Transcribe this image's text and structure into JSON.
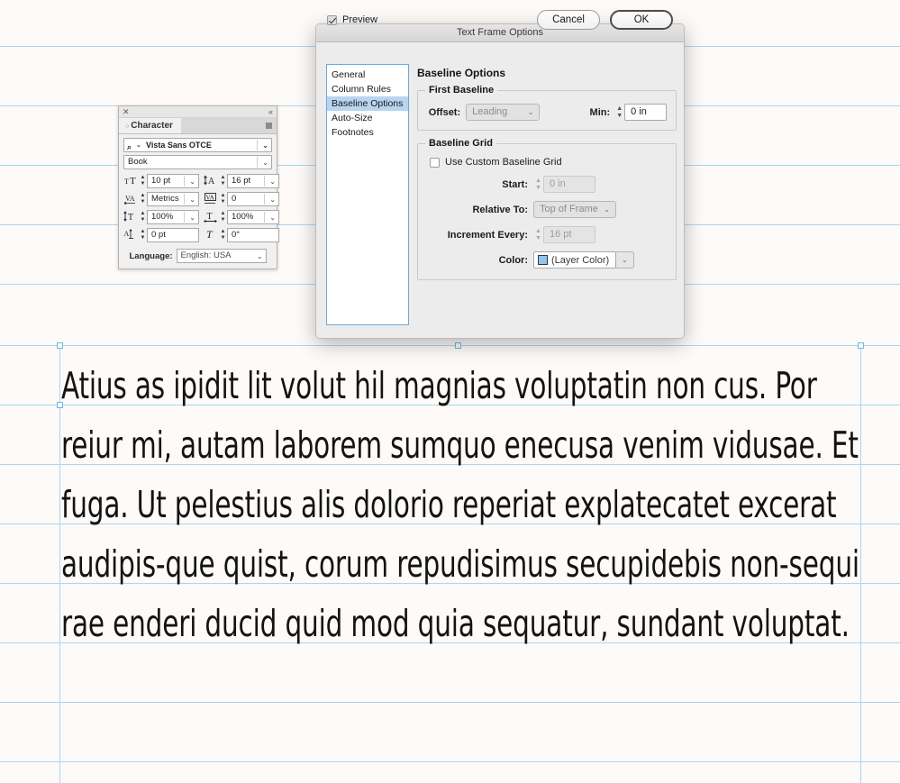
{
  "canvas": {
    "background_color": "#fdfaf7",
    "guide_color": "#a8d6f5",
    "horizontal_guides": [
      51,
      117,
      183,
      249,
      315,
      383,
      449,
      515,
      581,
      647,
      713,
      779,
      845
    ],
    "vertical_guides": [
      66,
      955
    ],
    "body_text": "Atius as ipidit lit volut hil magnias voluptatin non cus. Por reiur mi, autam laborem sumquo enecusa venim vidusae. Et fuga. Ut pelestius alis dolorio reperiat explatecatet excerat audipis-que quist, corum repudisimus secupidebis non-sequi rae enderi ducid quid mod quia sequatur, sundant voluptat.",
    "body_lines": [
      "Atius as ipidit lit volut hil magnias voluptatin",
      "non cus. Por reiur mi, autam laborem sumquo",
      "enecusa venim vidusae. Et fuga. Ut pelestius alis",
      "dolorio reperiat explatecatet excerat audipis-",
      "que quist, corum repudisimus secupidebis non-",
      "sequi rae enderi ducid quid mod quia sequatur,",
      "sundant voluptat."
    ]
  },
  "character_panel": {
    "close_glyph": "✕",
    "collapse_glyph": "«",
    "tab_label": "Character",
    "tab_dot": "○",
    "font_family": {
      "value": "Vista Sans OTCE",
      "search_glyph": "⌕",
      "caret": "⌄"
    },
    "font_style": {
      "value": "Book",
      "caret": "⌄"
    },
    "fields": [
      {
        "icon": "TT",
        "icon_name": "font-size-icon",
        "value": "10 pt",
        "has_dropdown": true
      },
      {
        "icon": "A",
        "icon_name": "leading-icon",
        "value": "16 pt",
        "has_dropdown": true
      },
      {
        "icon": "VA",
        "icon_name": "kerning-icon",
        "value": "Metrics",
        "has_dropdown": true
      },
      {
        "icon": "VA",
        "icon_name": "tracking-icon",
        "value": "0",
        "has_dropdown": true
      },
      {
        "icon": "T",
        "icon_name": "vertical-scale-icon",
        "value": "100%",
        "has_dropdown": true
      },
      {
        "icon": "T",
        "icon_name": "horizontal-scale-icon",
        "value": "100%",
        "has_dropdown": true
      },
      {
        "icon": "A",
        "icon_name": "baseline-shift-icon",
        "value": "0 pt",
        "has_dropdown": false
      },
      {
        "icon": "T",
        "icon_name": "skew-italic-icon",
        "value": "0°",
        "has_dropdown": false
      }
    ],
    "language_label": "Language:",
    "language_value": "English: USA",
    "language_caret": "⌄"
  },
  "dialog": {
    "title": "Text Frame Options",
    "tabs": [
      {
        "label": "General",
        "selected": false
      },
      {
        "label": "Column Rules",
        "selected": false
      },
      {
        "label": "Baseline Options",
        "selected": true
      },
      {
        "label": "Auto-Size",
        "selected": false
      },
      {
        "label": "Footnotes",
        "selected": false
      }
    ],
    "selected_tab_color": "#b9d4f0",
    "panel_heading": "Baseline Options",
    "first_baseline": {
      "group_title": "First Baseline",
      "offset_label": "Offset:",
      "offset_value": "Leading",
      "offset_caret": "⌄",
      "min_label": "Min:",
      "min_value": "0 in"
    },
    "baseline_grid": {
      "group_title": "Baseline Grid",
      "use_custom_label": "Use Custom Baseline Grid",
      "use_custom_checked": false,
      "start_label": "Start:",
      "start_value": "0 in",
      "relative_label": "Relative To:",
      "relative_value": "Top of Frame",
      "relative_caret": "⌄",
      "increment_label": "Increment Every:",
      "increment_value": "16 pt",
      "color_label": "Color:",
      "color_value": "(Layer Color)",
      "color_swatch_hex": "#8ec6f0",
      "color_caret": "⌄"
    },
    "footer": {
      "preview_label": "Preview",
      "preview_checked": true,
      "cancel_label": "Cancel",
      "ok_label": "OK"
    }
  }
}
